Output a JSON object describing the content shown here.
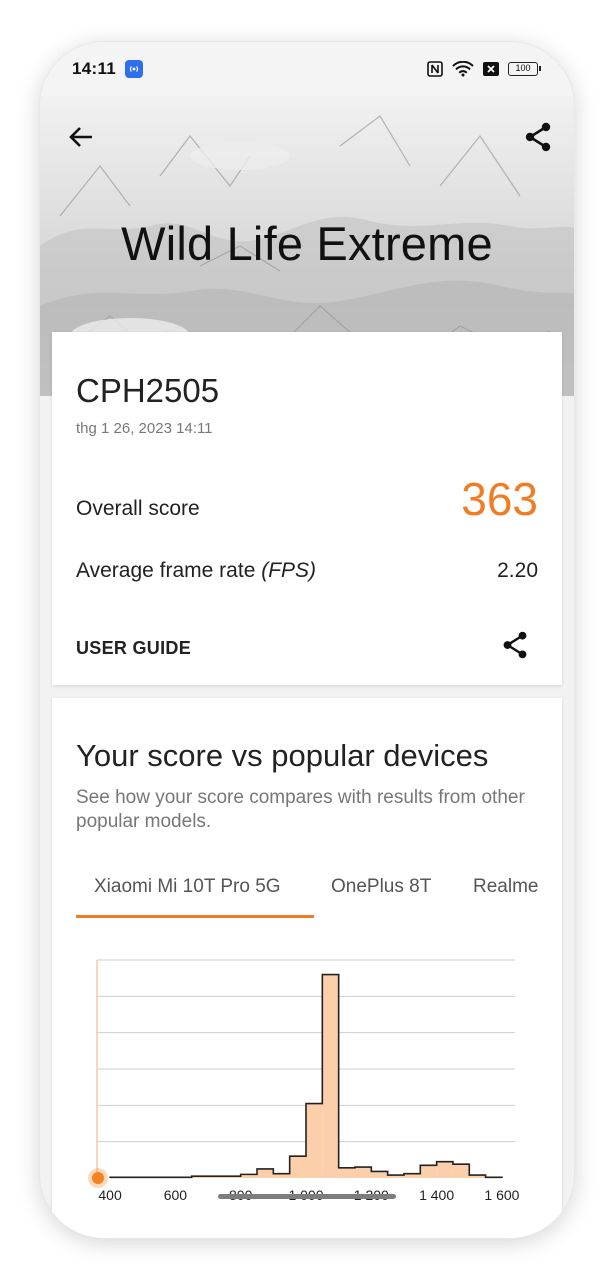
{
  "status_bar": {
    "time": "14:11",
    "battery": "100",
    "icons": [
      "notification-icon",
      "nfc-icon",
      "wifi-icon",
      "close-box-icon",
      "battery-icon"
    ]
  },
  "header": {
    "title": "Wild Life Extreme",
    "back_icon": "arrow-left-icon",
    "share_icon": "share-icon"
  },
  "result_card": {
    "device": "CPH2505",
    "date": "thg 1 26, 2023 14:11",
    "overall_score_label": "Overall score",
    "overall_score": "363",
    "fps_label_prefix": "Average frame rate ",
    "fps_label_unit": "(FPS)",
    "fps_value": "2.20",
    "user_guide_label": "USER GUIDE"
  },
  "comparison": {
    "title": "Your score vs popular devices",
    "subtitle": "See how your score compares with results from other popular models.",
    "tabs": [
      {
        "label": "Xiaomi Mi 10T Pro 5G",
        "selected": true
      },
      {
        "label": "OnePlus 8T",
        "selected": false
      },
      {
        "label": "Realme",
        "selected": false
      }
    ]
  },
  "chart_data": {
    "type": "bar",
    "title": "",
    "xlabel": "",
    "ylabel": "",
    "x_ticks": [
      "400",
      "600",
      "800",
      "1 000",
      "1 200",
      "1 400",
      "1 600"
    ],
    "xlim": [
      360,
      1640
    ],
    "ylim": [
      0,
      6
    ],
    "grid": true,
    "bin_edges": [
      400,
      450,
      500,
      550,
      600,
      650,
      700,
      750,
      800,
      850,
      900,
      950,
      1000,
      1050,
      1100,
      1150,
      1200,
      1250,
      1300,
      1350,
      1400,
      1450,
      1500,
      1550,
      1600
    ],
    "values": [
      0.02,
      0.02,
      0.02,
      0.02,
      0.02,
      0.05,
      0.05,
      0.05,
      0.1,
      0.25,
      0.12,
      0.6,
      2.05,
      5.6,
      0.28,
      0.3,
      0.18,
      0.08,
      0.12,
      0.35,
      0.45,
      0.38,
      0.08,
      0.02
    ],
    "bar_fill": "#fccfab",
    "bar_stroke": "#222222",
    "marker": {
      "x": 363,
      "label": "your score",
      "color": "#f58220"
    }
  }
}
